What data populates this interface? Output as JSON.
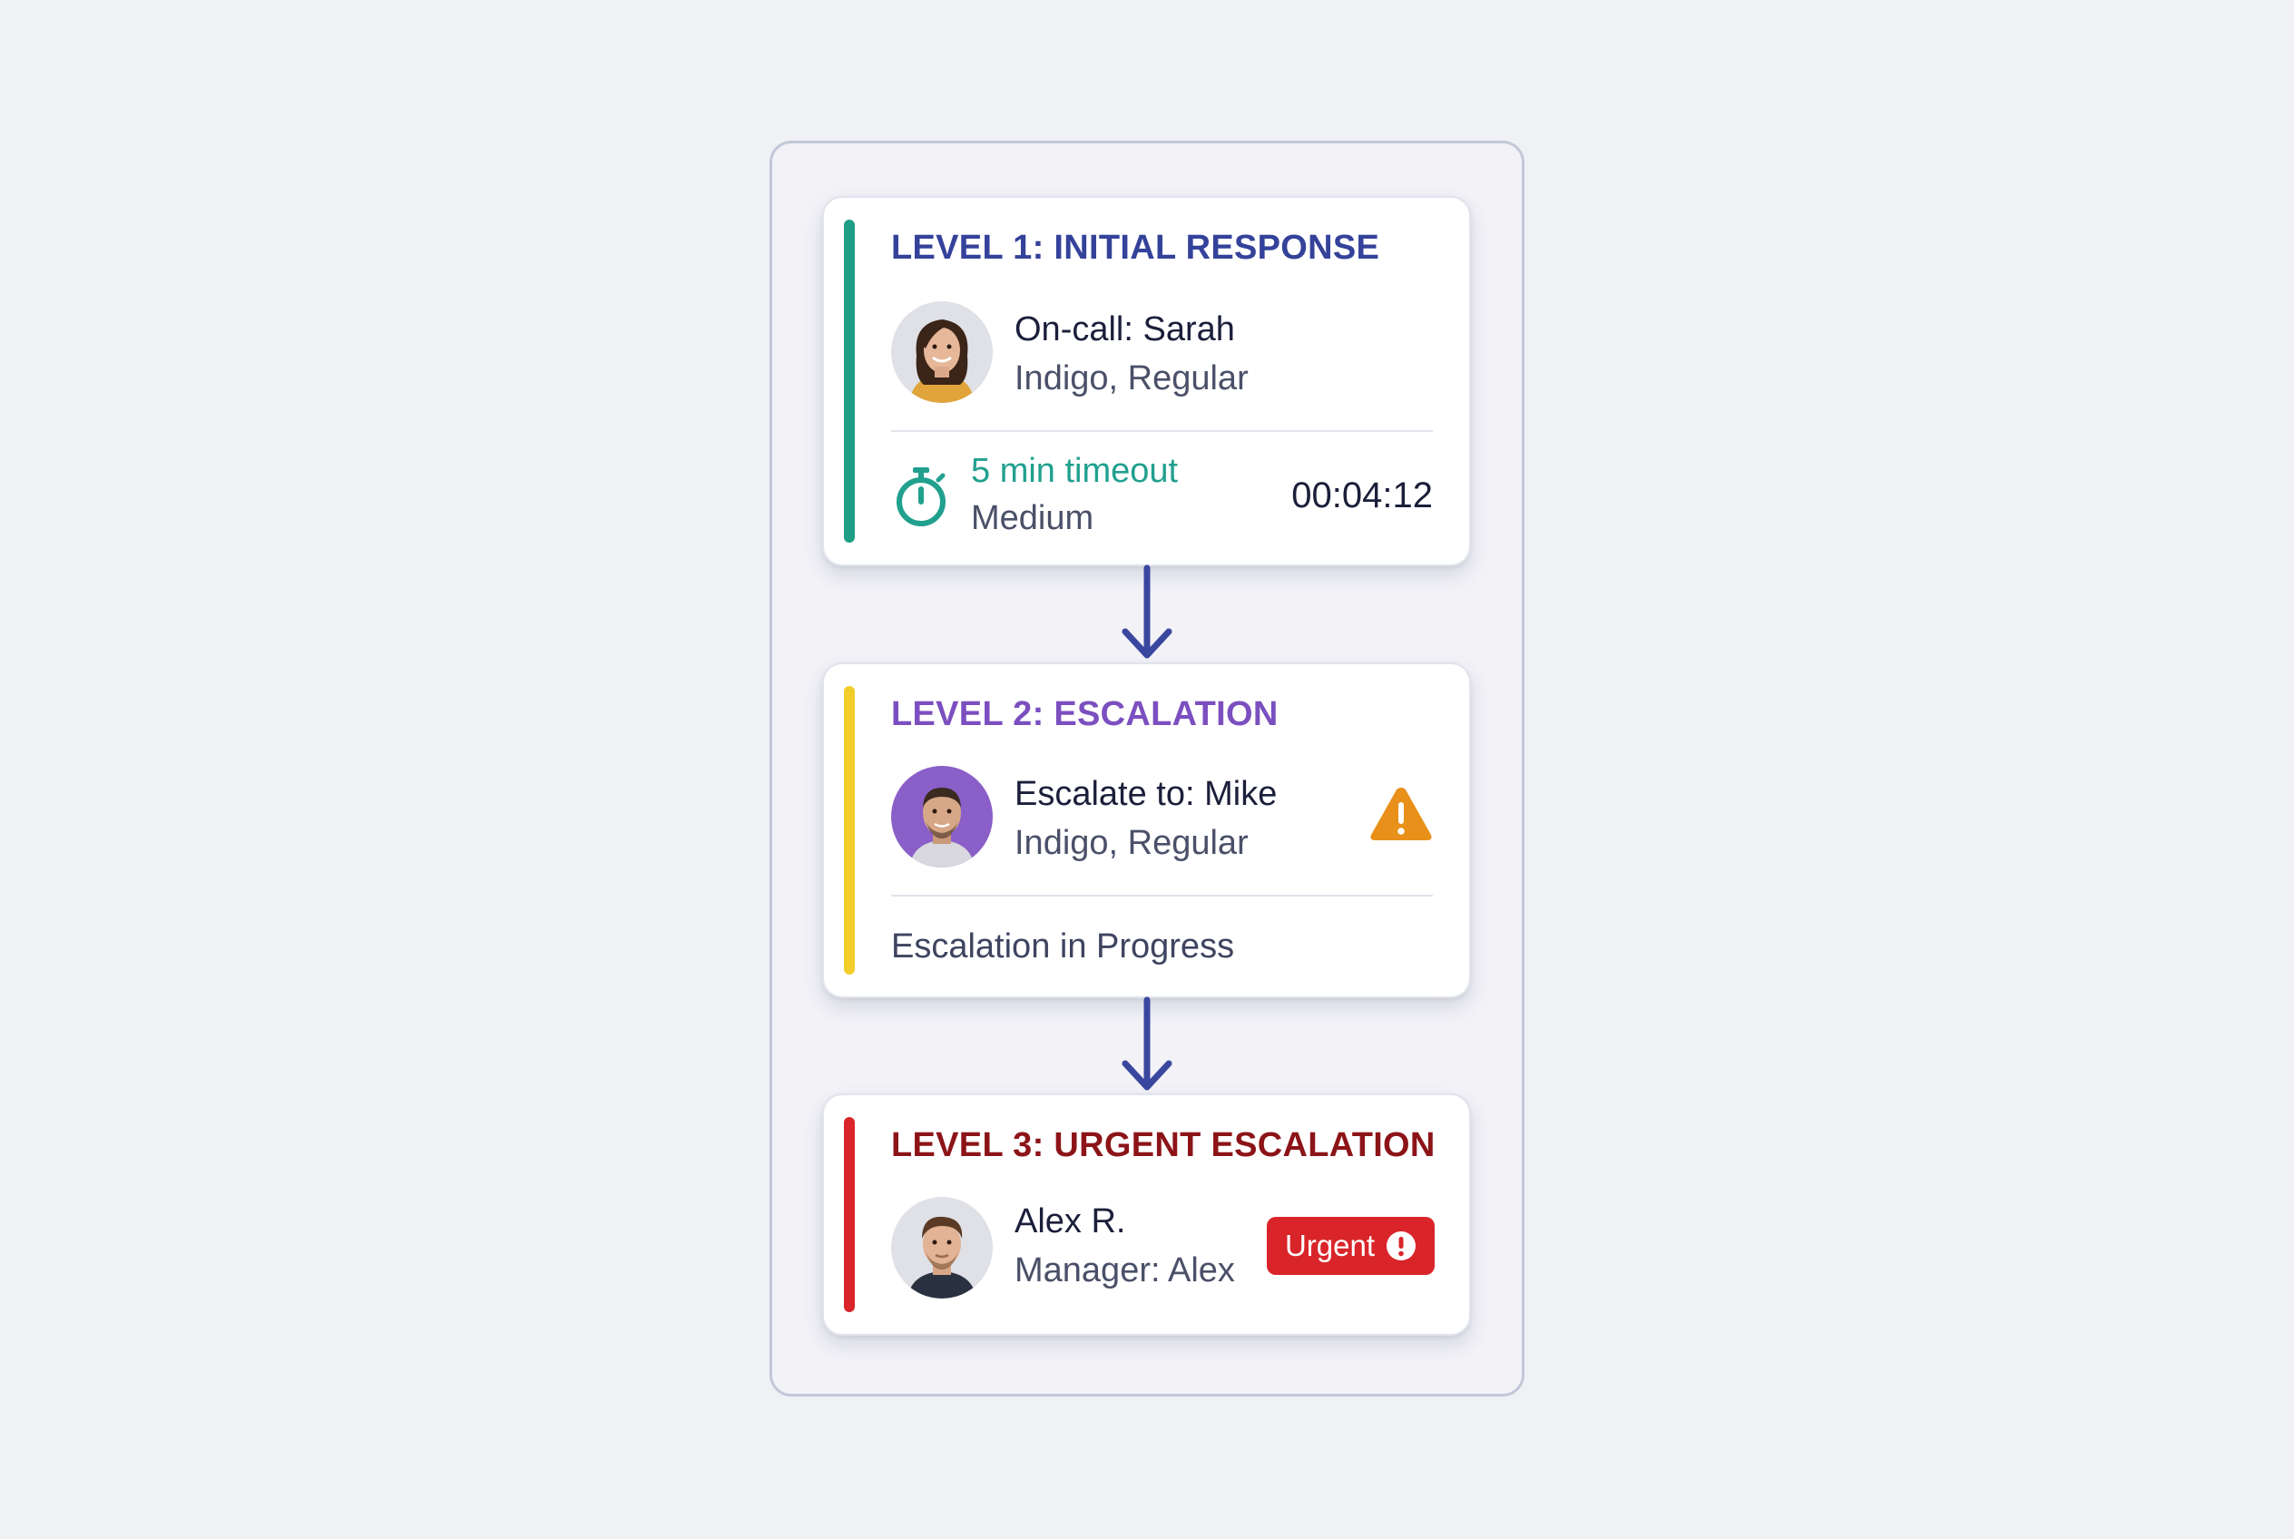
{
  "levels": [
    {
      "title": "LEVEL 1: INITIAL RESPONSE",
      "title_color": "#34429a",
      "accent_color": "#1f9e86",
      "person_name": "On-call: Sarah",
      "person_sub": "Indigo, Regular",
      "avatar_icon": "avatar-woman",
      "timeout_label": "5 min timeout",
      "timeout_color": "#21a08e",
      "priority": "Medium",
      "countdown": "00:04:12",
      "timer_icon": "stopwatch-icon"
    },
    {
      "title": "LEVEL 2: ESCALATION",
      "title_color": "#7b4fc0",
      "accent_color": "#f2cd2a",
      "person_name": "Escalate to: Mike",
      "person_sub": "Indigo, Regular",
      "avatar_icon": "avatar-man-purple-bg",
      "status": "Escalation in Progress",
      "warning_icon": "warning-triangle-icon",
      "warning_color": "#e8901a"
    },
    {
      "title": "LEVEL 3: URGENT ESCALATION",
      "title_color": "#8c1418",
      "accent_color": "#d9252a",
      "person_name": "Alex R.",
      "person_sub": "Manager: Alex",
      "avatar_icon": "avatar-man",
      "badge_label": "Urgent",
      "badge_color": "#d9252a",
      "badge_icon": "exclamation-circle-icon"
    }
  ],
  "arrow_color": "#3a479e"
}
